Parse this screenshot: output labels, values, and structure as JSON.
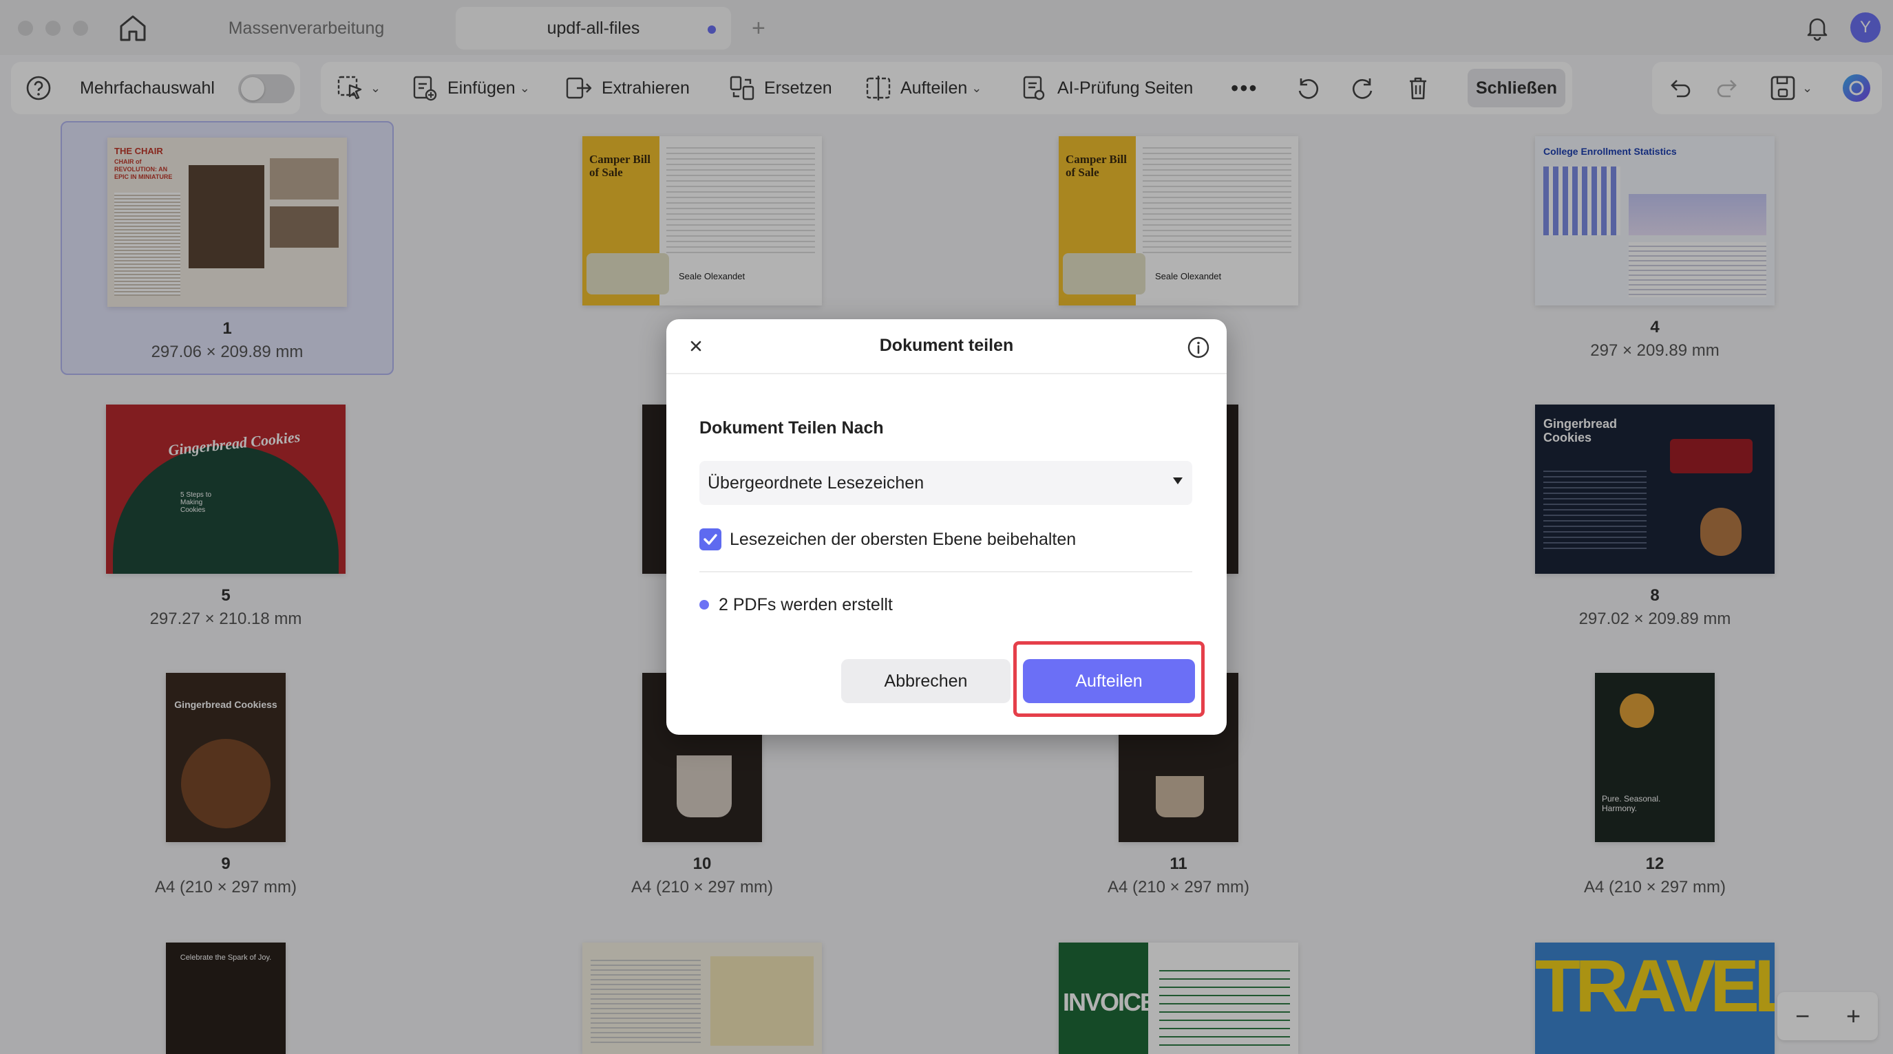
{
  "titlebar": {
    "tabs": [
      {
        "label": "Massenverarbeitung",
        "active": false
      },
      {
        "label": "updf-all-files",
        "active": true
      }
    ],
    "avatar_letter": "Y"
  },
  "toolbar": {
    "multi_select_label": "Mehrfachauswahl",
    "multi_select_on": false,
    "insert_label": "Einfügen",
    "extract_label": "Extrahieren",
    "replace_label": "Ersetzen",
    "split_label": "Aufteilen",
    "ai_label": "AI-Prüfung Seiten",
    "close_label": "Schließen"
  },
  "pages": [
    {
      "num": "1",
      "size": "297.06 × 209.89 mm",
      "selected": true
    },
    {
      "num": "",
      "size": "297"
    },
    {
      "num": "",
      "size": "mm"
    },
    {
      "num": "4",
      "size": "297 × 209.89 mm"
    },
    {
      "num": "5",
      "size": "297.27 × 210.18 mm"
    },
    {
      "num": "",
      "size": "A4 (20"
    },
    {
      "num": "",
      "size": "06 mm)"
    },
    {
      "num": "8",
      "size": "297.02 × 209.89 mm"
    },
    {
      "num": "9",
      "size": "A4 (210 × 297 mm)"
    },
    {
      "num": "10",
      "size": "A4 (210 × 297 mm)"
    },
    {
      "num": "11",
      "size": "A4 (210 × 297 mm)"
    },
    {
      "num": "12",
      "size": "A4 (210 × 297 mm)"
    }
  ],
  "thumb_text": {
    "chair_title": "THE CHAIR",
    "chair_sub": "CHAIR of REVOLUTION: AN EPIC IN MINIATURE",
    "camper_title": "Camper Bill of Sale",
    "camper_sign": "Seale Olexandet",
    "college_title": "College Enrollment Statistics",
    "cookies_title": "Gingerbread Cookies",
    "cookies_steps": "5 Steps to Making Cookies",
    "gingerbread_title": "Gingerbread Cookiess",
    "harmony": "Pure. Seasonal. Harmony.",
    "celebrate": "Celebrate the Spark of Joy.",
    "invoice": "INVOICE",
    "travel": "TRAVEL"
  },
  "dialog": {
    "title": "Dokument teilen",
    "section_label": "Dokument Teilen Nach",
    "select_value": "Übergeordnete Lesezeichen",
    "checkbox_label": "Lesezeichen der obersten Ebene beibehalten",
    "checkbox_checked": true,
    "info_text": "2 PDFs werden erstellt",
    "cancel_label": "Abbrechen",
    "confirm_label": "Aufteilen"
  },
  "zoom": {
    "minus": "−",
    "plus": "+"
  },
  "colors": {
    "accent": "#6b6ff6",
    "highlight": "#e53f4a",
    "selected_bg": "#e3e5fb"
  }
}
